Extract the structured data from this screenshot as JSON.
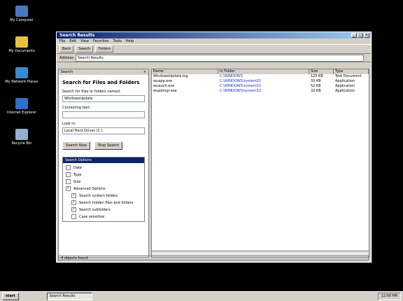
{
  "desktop": {
    "icons": [
      {
        "label": "My Computer",
        "color": "#4a78c0"
      },
      {
        "label": "My Documents",
        "color": "#e8c040"
      },
      {
        "label": "My Network Places",
        "color": "#3a88d0"
      },
      {
        "label": "Internet Explorer",
        "color": "#2f6fc8"
      },
      {
        "label": "Recycle Bin",
        "color": "#8fb0d0"
      }
    ]
  },
  "window": {
    "title": "Search Results",
    "menus": [
      "File",
      "Edit",
      "View",
      "Favorites",
      "Tools",
      "Help"
    ],
    "toolbar": [
      "Back",
      "Search",
      "Folders"
    ],
    "address_label": "Address",
    "address_value": "Search Results",
    "search_pane": {
      "header": "Search",
      "title": "Search for Files and Folders",
      "name_label": "Search for files or folders named:",
      "name_value": "WindowsUpdate",
      "containing_label": "Containing text:",
      "containing_value": "",
      "lookin_label": "Look in:",
      "lookin_value": "Local Hard Drives (C:)",
      "search_button": "Search Now",
      "stop_button": "Stop Search",
      "options_header": "Search Options",
      "options": [
        {
          "label": "Date",
          "checked": false,
          "sub": false
        },
        {
          "label": "Type",
          "checked": false,
          "sub": false
        },
        {
          "label": "Size",
          "checked": false,
          "sub": false
        },
        {
          "label": "Advanced Options",
          "checked": true,
          "sub": false
        },
        {
          "label": "Search system folders",
          "checked": true,
          "sub": true
        },
        {
          "label": "Search hidden files and folders",
          "checked": true,
          "sub": true
        },
        {
          "label": "Search subfolders",
          "checked": true,
          "sub": true
        },
        {
          "label": "Case sensitive",
          "checked": false,
          "sub": true
        }
      ]
    },
    "results": {
      "columns": [
        "Name",
        "In Folder",
        "Size",
        "Type"
      ],
      "rows": [
        {
          "name": "WindowsUpdate.log",
          "folder": "C:\\WINDOWS",
          "size": "125 KB",
          "type": "Text Document"
        },
        {
          "name": "wuapp.exe",
          "folder": "C:\\WINDOWS\\system32",
          "size": "33 KB",
          "type": "Application"
        },
        {
          "name": "wuauclt.exe",
          "folder": "C:\\WINDOWS\\system32",
          "size": "52 KB",
          "type": "Application"
        },
        {
          "name": "wupdmgr.exe",
          "folder": "C:\\WINDOWS\\system32",
          "size": "32 KB",
          "type": "Application"
        }
      ]
    },
    "status": "4 objects found"
  },
  "taskbar": {
    "start": "start",
    "task": "Search Results",
    "clock": "12:00 PM"
  }
}
